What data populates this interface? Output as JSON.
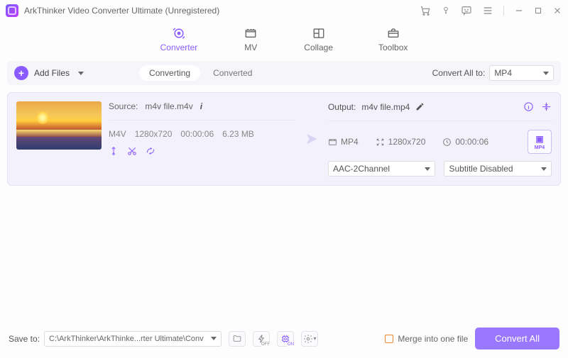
{
  "title": "ArkThinker Video Converter Ultimate (Unregistered)",
  "tabs": {
    "converter": "Converter",
    "mv": "MV",
    "collage": "Collage",
    "toolbox": "Toolbox"
  },
  "toolbar": {
    "add": "Add Files",
    "seg_converting": "Converting",
    "seg_converted": "Converted",
    "convert_all_label": "Convert All to:",
    "convert_all_value": "MP4"
  },
  "file": {
    "source_label": "Source:",
    "source_name": "m4v file.m4v",
    "fmt": "M4V",
    "res": "1280x720",
    "dur": "00:00:06",
    "size": "6.23 MB",
    "output_label": "Output:",
    "output_name": "m4v file.mp4",
    "out_fmt": "MP4",
    "out_res": "1280x720",
    "out_dur": "00:00:06",
    "audio_sel": "AAC-2Channel",
    "sub_sel": "Subtitle Disabled",
    "fmt_badge": "MP4"
  },
  "bottom": {
    "saveto": "Save to:",
    "path": "C:\\ArkThinker\\ArkThinke...rter Ultimate\\Converted",
    "merge": "Merge into one file",
    "convert": "Convert All",
    "off": "OFF",
    "on": "ON"
  }
}
